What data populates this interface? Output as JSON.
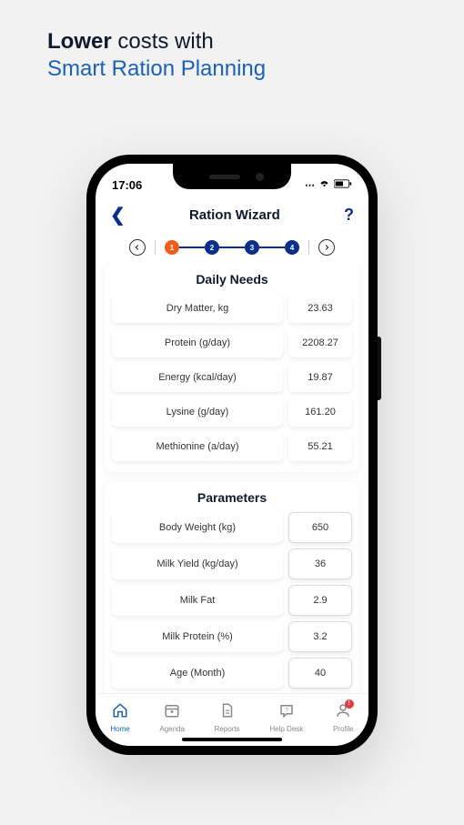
{
  "headline": {
    "bold": "Lower",
    "rest": "costs with",
    "sub": "Smart Ration Planning"
  },
  "statusbar": {
    "time": "17:06"
  },
  "nav": {
    "title": "Ration Wizard",
    "help": "?"
  },
  "stepper": {
    "steps": [
      "1",
      "2",
      "3",
      "4"
    ]
  },
  "daily_needs": {
    "title": "Daily Needs",
    "rows": [
      {
        "label": "Dry Matter, kg",
        "value": "23.63"
      },
      {
        "label": "Protein (g/day)",
        "value": "2208.27"
      },
      {
        "label": "Energy (kcal/day)",
        "value": "19.87"
      },
      {
        "label": "Lysine (g/day)",
        "value": "161.20"
      },
      {
        "label": "Methionine (a/day)",
        "value": "55.21"
      }
    ]
  },
  "parameters": {
    "title": "Parameters",
    "rows": [
      {
        "label": "Body Weight (kg)",
        "value": "650"
      },
      {
        "label": "Milk Yield (kg/day)",
        "value": "36"
      },
      {
        "label": "Milk Fat",
        "value": "2.9"
      },
      {
        "label": "Milk Protein (%)",
        "value": "3.2"
      },
      {
        "label": "Age (Month)",
        "value": "40"
      }
    ]
  },
  "tabs": {
    "home": "Home",
    "agenda": "Agenda",
    "reports": "Reports",
    "helpdesk": "Help Desk",
    "profile": "Profile",
    "badge": "!"
  }
}
